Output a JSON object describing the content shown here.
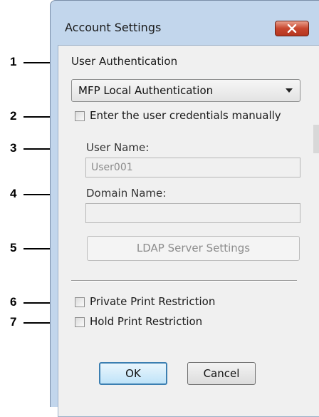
{
  "window": {
    "title": "Account Settings",
    "close_icon": "close-icon"
  },
  "callouts": [
    "1",
    "2",
    "3",
    "4",
    "5",
    "6",
    "7"
  ],
  "user_auth": {
    "label": "User Authentication",
    "selected": "MFP Local Authentication"
  },
  "manual": {
    "label": "Enter the user credentials manually",
    "checked": false
  },
  "user_name": {
    "label": "User Name:",
    "value": "User001"
  },
  "domain_name": {
    "label": "Domain Name:",
    "value": ""
  },
  "ldap": {
    "label": "LDAP Server Settings"
  },
  "private_print": {
    "label": "Private Print Restriction",
    "checked": false
  },
  "hold_print": {
    "label": "Hold Print Restriction",
    "checked": false
  },
  "buttons": {
    "ok": "OK",
    "cancel": "Cancel"
  }
}
